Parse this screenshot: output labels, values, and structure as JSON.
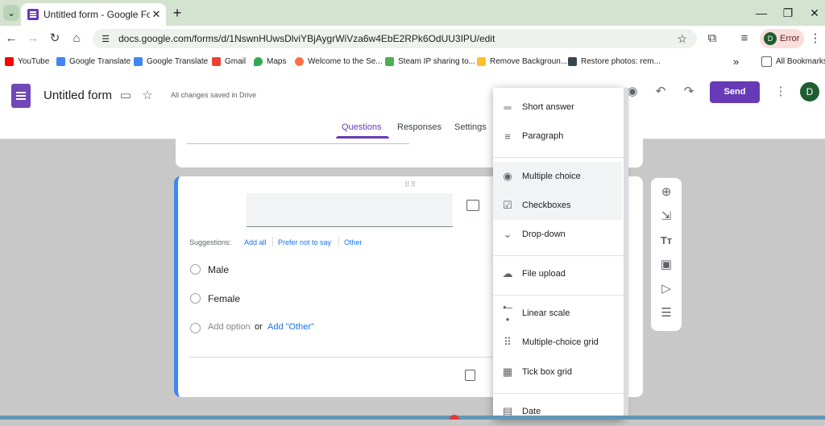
{
  "browser": {
    "tab_title": "Untitled form - Google Forms",
    "tab_close": "✕",
    "new_tab": "+",
    "url": "docs.google.com/forms/d/1NswnHUwsDlviYBjAygrWiVza6w4EbE2RPk6OdUU3IPU/edit",
    "profile_initial": "D",
    "profile_status": "Error",
    "bookmarks": [
      "YouTube",
      "Google Translate",
      "Google Translate",
      "Gmail",
      "Maps",
      "Welcome to the Se...",
      "Steam IP sharing to...",
      "Remove Backgroun...",
      "Restore photos: rem..."
    ],
    "bookmarks_overflow": "»",
    "all_bookmarks": "All Bookmarks"
  },
  "form_header": {
    "title": "Untitled form",
    "saved_status": "All changes saved in Drive",
    "send_label": "Send",
    "avatar_initial": "D",
    "tabs": [
      "Questions",
      "Responses",
      "Settings"
    ],
    "active_tab": "Questions"
  },
  "question": {
    "suggestions_label": "Suggestions:",
    "suggestions": [
      "Add all",
      "Prefer not to say",
      "Other"
    ],
    "options": [
      "Male",
      "Female"
    ],
    "add_option": "Add option",
    "or": "or",
    "add_other": "Add \"Other\""
  },
  "type_menu": {
    "items": [
      "Short answer",
      "Paragraph",
      "Multiple choice",
      "Checkboxes",
      "Drop-down",
      "File upload",
      "Linear scale",
      "Multiple-choice grid",
      "Tick box grid",
      "Date"
    ],
    "highlighted": [
      "Multiple choice",
      "Checkboxes"
    ]
  },
  "colors": {
    "accent": "#673ab7",
    "link": "#1a73e8",
    "question_border": "#4285f4",
    "canvas": "#c8c8c8"
  }
}
